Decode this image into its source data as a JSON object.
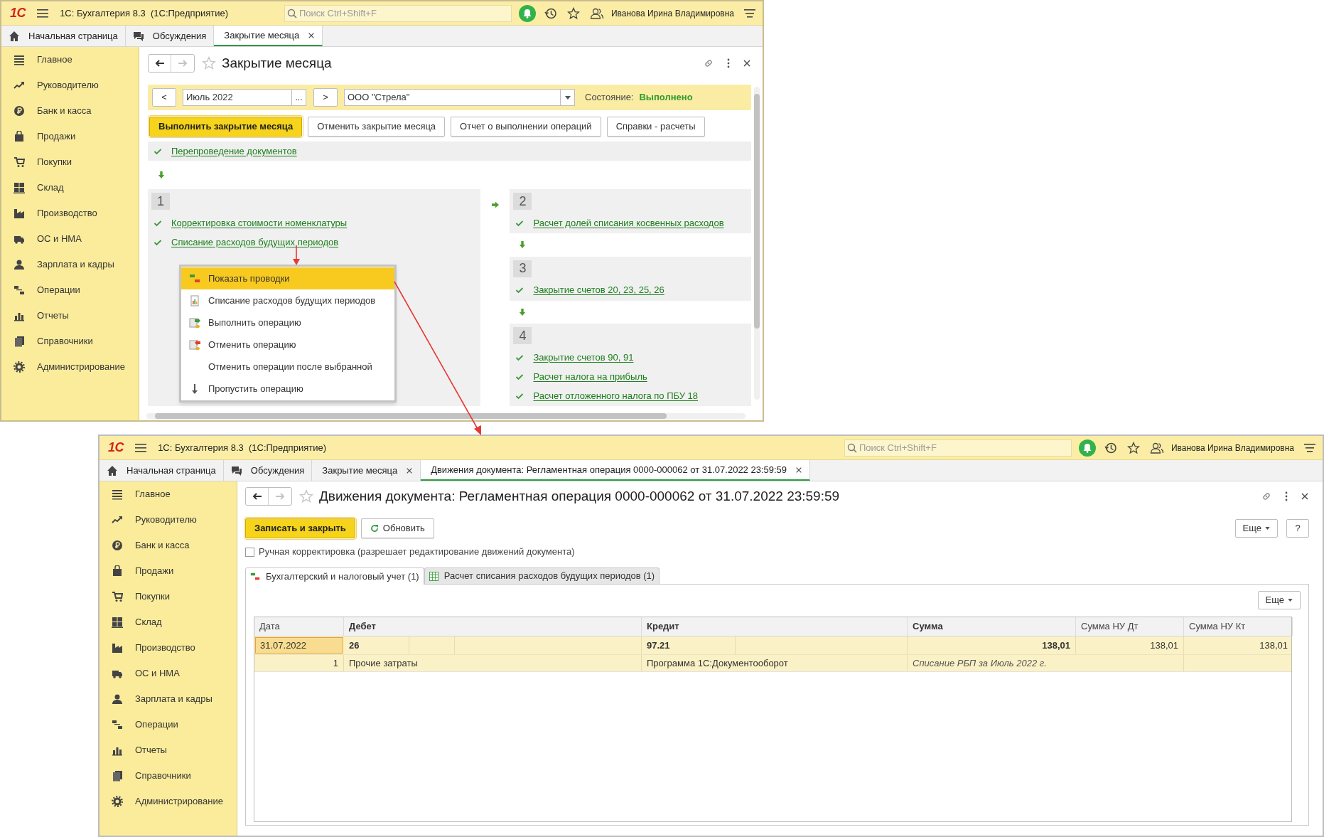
{
  "windows": [
    {
      "logo": "1С",
      "app_title": "1С: Бухгалтерия 8.3  (1С:Предприятие)",
      "search": {
        "placeholder": "Поиск Ctrl+Shift+F"
      },
      "user": "Иванова Ирина Владимировна",
      "tabs": [
        {
          "label": "Начальная страница",
          "selected": false,
          "closable": false
        },
        {
          "label": "Обсуждения",
          "selected": false,
          "closable": false
        },
        {
          "label": "Закрытие месяца",
          "selected": true,
          "closable": true
        }
      ],
      "sidebar": {
        "items": [
          "Главное",
          "Руководителю",
          "Банк и касса",
          "Продажи",
          "Покупки",
          "Склад",
          "Производство",
          "ОС и НМА",
          "Зарплата и кадры",
          "Операции",
          "Отчеты",
          "Справочники",
          "Администрирование"
        ]
      },
      "form": {
        "kind": "month_closing",
        "title": "Закрытие месяца",
        "period": {
          "prev": "<",
          "value": "Июль 2022",
          "choose": "...",
          "next": ">"
        },
        "organization": "ООО \"Стрела\"",
        "state_label": "Состояние:",
        "state": "Выполнено",
        "buttons": [
          {
            "label": "Выполнить закрытие месяца",
            "primary": true
          },
          {
            "label": "Отменить закрытие месяца",
            "primary": false
          },
          {
            "label": "Отчет о выполнении операций",
            "primary": false
          },
          {
            "label": "Справки - расчеты",
            "primary": false
          }
        ],
        "pre_step": {
          "label": "Перепроведение документов",
          "done": true
        },
        "stages": [
          {
            "number": "1",
            "operations": [
              {
                "label": "Корректировка стоимости номенклатуры",
                "done": true
              },
              {
                "label": "Списание расходов будущих периодов",
                "done": true
              }
            ]
          },
          {
            "number": "2",
            "operations": [
              {
                "label": "Расчет долей списания косвенных расходов",
                "done": true
              }
            ]
          },
          {
            "number": "3",
            "operations": [
              {
                "label": "Закрытие счетов 20, 23, 25, 26",
                "done": true
              }
            ]
          },
          {
            "number": "4",
            "operations": [
              {
                "label": "Закрытие счетов 90, 91",
                "done": true
              },
              {
                "label": "Расчет налога на прибыль",
                "done": true
              },
              {
                "label": "Расчет отложенного налога по ПБУ 18",
                "done": true
              }
            ]
          }
        ],
        "context_menu": {
          "items": [
            {
              "label": "Показать проводки",
              "selected": true
            },
            {
              "label": "Списание расходов будущих периодов",
              "selected": false
            },
            {
              "label": "Выполнить операцию",
              "selected": false
            },
            {
              "label": "Отменить операцию",
              "selected": false
            },
            {
              "label": "Отменить операции после выбранной",
              "selected": false
            },
            {
              "label": "Пропустить операцию",
              "selected": false
            }
          ]
        }
      }
    },
    {
      "logo": "1С",
      "app_title": "1С: Бухгалтерия 8.3  (1С:Предприятие)",
      "search": {
        "placeholder": "Поиск Ctrl+Shift+F"
      },
      "user": "Иванова Ирина Владимировна",
      "tabs": [
        {
          "label": "Начальная страница",
          "selected": false,
          "closable": false
        },
        {
          "label": "Обсуждения",
          "selected": false,
          "closable": false
        },
        {
          "label": "Закрытие месяца",
          "selected": false,
          "closable": true
        },
        {
          "label": "Движения документа: Регламентная операция 0000-000062 от 31.07.2022 23:59:59",
          "selected": true,
          "closable": true
        }
      ],
      "sidebar": {
        "items": [
          "Главное",
          "Руководителю",
          "Банк и касса",
          "Продажи",
          "Покупки",
          "Склад",
          "Производство",
          "ОС и НМА",
          "Зарплата и кадры",
          "Операции",
          "Отчеты",
          "Справочники",
          "Администрирование"
        ]
      },
      "form": {
        "kind": "document_movements",
        "title": "Движения документа: Регламентная операция 0000-000062 от 31.07.2022 23:59:59",
        "buttons": [
          {
            "label": "Записать и закрыть",
            "primary": true
          },
          {
            "label": "Обновить",
            "primary": false
          }
        ],
        "more": "Еще",
        "help": "?",
        "manual_edit": {
          "label": "Ручная корректировка (разрешает редактирование движений документа)",
          "checked": false
        },
        "tabs": [
          {
            "label": "Бухгалтерский и налоговый учет (1)",
            "selected": true
          },
          {
            "label": "Расчет списания расходов будущих периодов (1)",
            "selected": false
          }
        ],
        "table_more": "Еще",
        "table": {
          "columns": [
            "Дата",
            "Дебет",
            "Кредит",
            "Сумма",
            "Сумма НУ Дт",
            "Сумма НУ Кт"
          ],
          "rows": [
            {
              "selected": true,
              "date": "31.07.2022",
              "number": "1",
              "debit": "26",
              "debit_analytics": "Прочие затраты",
              "credit": "97.21",
              "credit_analytics": "Программа 1С:Документооборот",
              "amount": "138,01",
              "content": "Списание РБП за Июль 2022 г.",
              "tax_debit_amount": "138,01",
              "tax_credit_amount": "138,01"
            }
          ]
        }
      }
    }
  ]
}
